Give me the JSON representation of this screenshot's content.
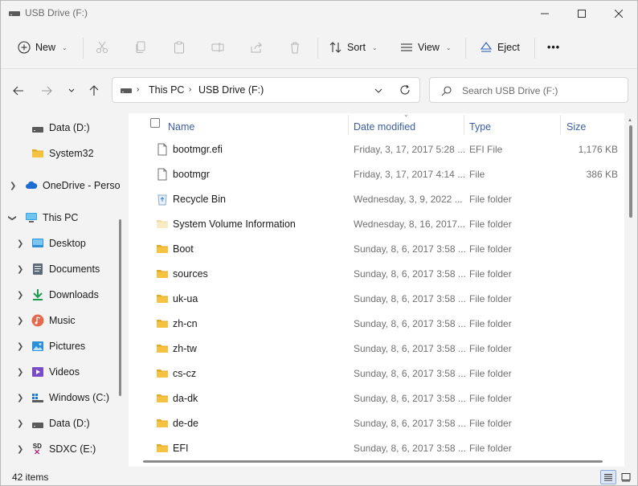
{
  "window": {
    "title": "USB Drive (F:)"
  },
  "toolbar": {
    "new_label": "New",
    "sort_label": "Sort",
    "view_label": "View",
    "eject_label": "Eject",
    "more_label": "•••"
  },
  "address": {
    "crumbs": [
      "This PC",
      "USB Drive (F:)"
    ]
  },
  "search": {
    "placeholder": "Search USB Drive (F:)"
  },
  "nav": {
    "items": [
      {
        "label": "Data (D:)",
        "icon": "drive-icon"
      },
      {
        "label": "System32",
        "icon": "folder-icon"
      },
      {
        "label": "OneDrive - Perso",
        "icon": "cloud-icon"
      },
      {
        "label": "This PC",
        "icon": "computer-icon"
      },
      {
        "label": "Desktop",
        "icon": "desktop-icon"
      },
      {
        "label": "Documents",
        "icon": "documents-icon"
      },
      {
        "label": "Downloads",
        "icon": "downloads-icon"
      },
      {
        "label": "Music",
        "icon": "music-icon"
      },
      {
        "label": "Pictures",
        "icon": "pictures-icon"
      },
      {
        "label": "Videos",
        "icon": "videos-icon"
      },
      {
        "label": "Windows (C:)",
        "icon": "windows-drive-icon"
      },
      {
        "label": "Data (D:)",
        "icon": "drive-icon"
      },
      {
        "label": "SDXC (E:)",
        "icon": "sd-card-icon"
      }
    ]
  },
  "columns": {
    "name": "Name",
    "date": "Date modified",
    "type": "Type",
    "size": "Size"
  },
  "files": [
    {
      "name": "bootmgr.efi",
      "date": "Friday, 3, 17, 2017 5:28 ...",
      "type": "EFI File",
      "size": "1,176 KB",
      "icon": "file-icon"
    },
    {
      "name": "bootmgr",
      "date": "Friday, 3, 17, 2017 4:14 ...",
      "type": "File",
      "size": "386 KB",
      "icon": "file-icon"
    },
    {
      "name": "Recycle Bin",
      "date": "Wednesday, 3, 9, 2022 ...",
      "type": "File folder",
      "size": "",
      "icon": "recycle-bin-icon"
    },
    {
      "name": "System Volume Information",
      "date": "Wednesday, 8, 16, 2017...",
      "type": "File folder",
      "size": "",
      "icon": "folder-light-icon"
    },
    {
      "name": "Boot",
      "date": "Sunday, 8, 6, 2017 3:58 ...",
      "type": "File folder",
      "size": "",
      "icon": "folder-icon"
    },
    {
      "name": "sources",
      "date": "Sunday, 8, 6, 2017 3:58 ...",
      "type": "File folder",
      "size": "",
      "icon": "folder-icon"
    },
    {
      "name": "uk-ua",
      "date": "Sunday, 8, 6, 2017 3:58 ...",
      "type": "File folder",
      "size": "",
      "icon": "folder-icon"
    },
    {
      "name": "zh-cn",
      "date": "Sunday, 8, 6, 2017 3:58 ...",
      "type": "File folder",
      "size": "",
      "icon": "folder-icon"
    },
    {
      "name": "zh-tw",
      "date": "Sunday, 8, 6, 2017 3:58 ...",
      "type": "File folder",
      "size": "",
      "icon": "folder-icon"
    },
    {
      "name": "cs-cz",
      "date": "Sunday, 8, 6, 2017 3:58 ...",
      "type": "File folder",
      "size": "",
      "icon": "folder-icon"
    },
    {
      "name": "da-dk",
      "date": "Sunday, 8, 6, 2017 3:58 ...",
      "type": "File folder",
      "size": "",
      "icon": "folder-icon"
    },
    {
      "name": "de-de",
      "date": "Sunday, 8, 6, 2017 3:58 ...",
      "type": "File folder",
      "size": "",
      "icon": "folder-icon"
    },
    {
      "name": "EFI",
      "date": "Sunday, 8, 6, 2017 3:58 ...",
      "type": "File folder",
      "size": "",
      "icon": "folder-icon"
    }
  ],
  "status": {
    "item_count": "42 items"
  },
  "colors": {
    "accent": "#3c5ea6",
    "folder": "#f5c242",
    "folder_dark": "#e3a923"
  }
}
